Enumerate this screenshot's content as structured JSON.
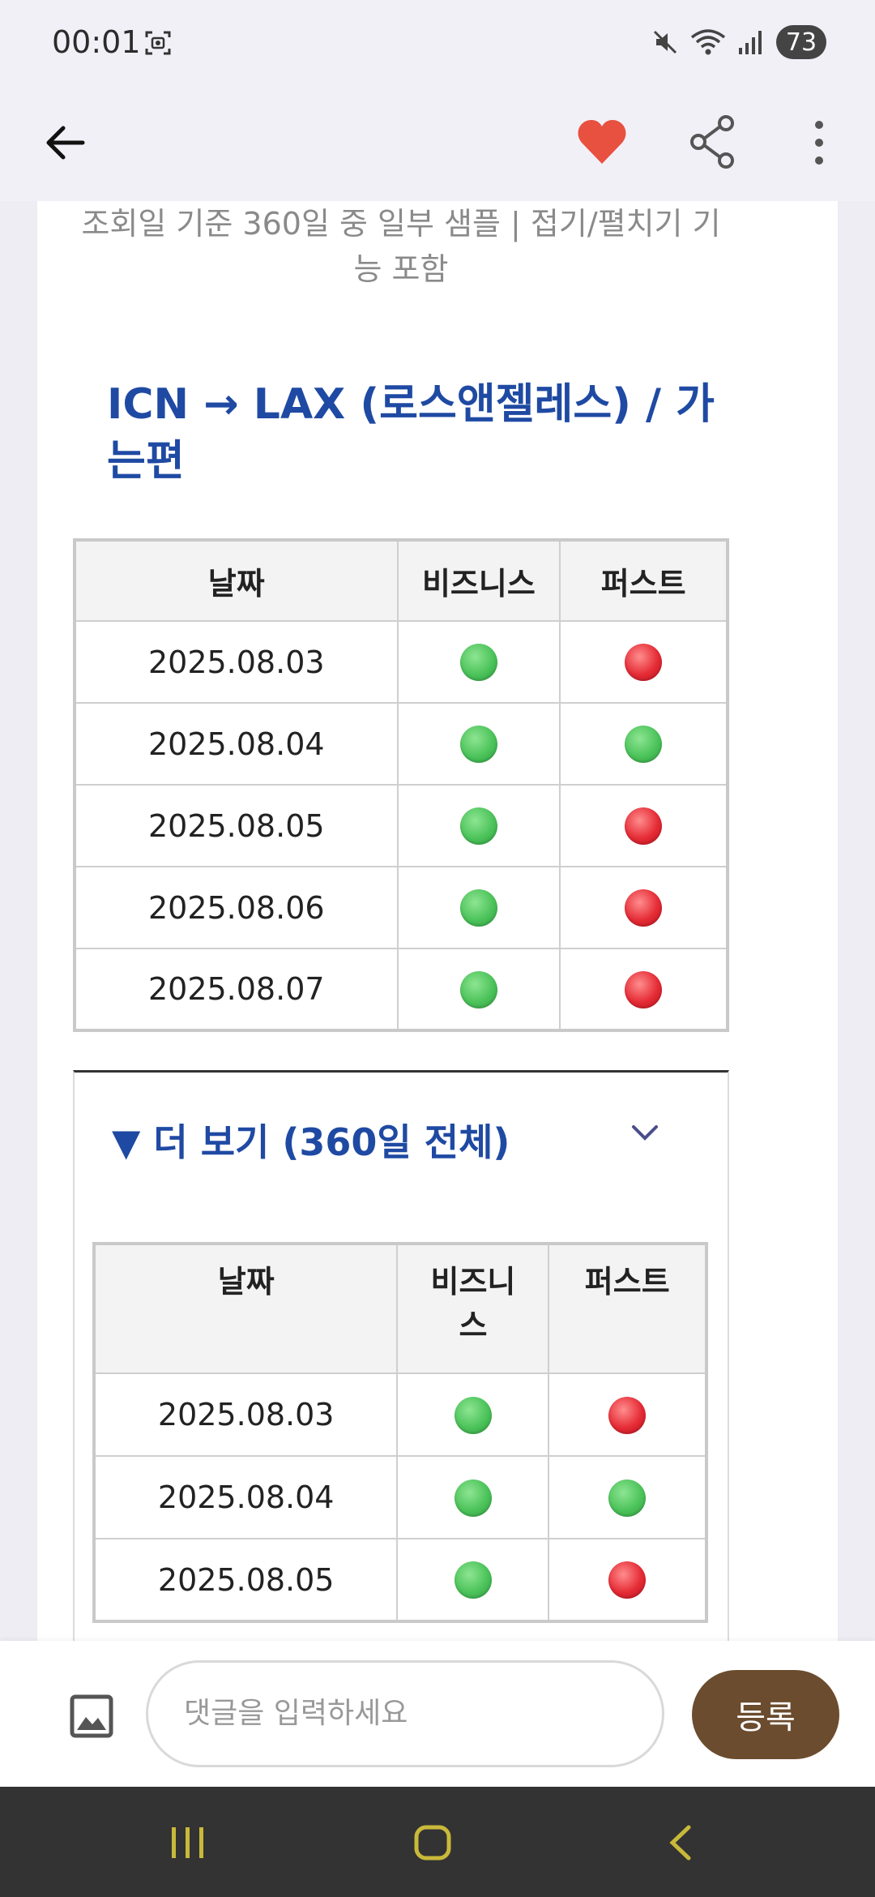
{
  "status_bar": {
    "time": "00:01",
    "battery": "73"
  },
  "app_bar": {
    "back_icon": "arrow-left-icon",
    "favorite_icon": "heart-icon",
    "share_icon": "share-icon",
    "more_icon": "more-vertical-icon",
    "favorite_color": "#e8503f"
  },
  "content": {
    "subtitle": "조회일 기준 360일 중 일부 샘플 | 접기/펼치기 기능 포함",
    "section_title": "ICN → LAX (로스앤젤레스) / 가는편",
    "table1": {
      "headers": [
        "날짜",
        "비즈니스",
        "퍼스트"
      ],
      "rows": [
        {
          "date": "2025.08.03",
          "business": "green",
          "first": "red"
        },
        {
          "date": "2025.08.04",
          "business": "green",
          "first": "green"
        },
        {
          "date": "2025.08.05",
          "business": "green",
          "first": "red"
        },
        {
          "date": "2025.08.06",
          "business": "green",
          "first": "red"
        },
        {
          "date": "2025.08.07",
          "business": "green",
          "first": "red"
        }
      ]
    },
    "details": {
      "summary": "▼ 더 보기 (360일 전체)",
      "table": {
        "headers": [
          "날짜",
          "비즈니스",
          "퍼스트"
        ],
        "rows": [
          {
            "date": "2025.08.03",
            "business": "green",
            "first": "red"
          },
          {
            "date": "2025.08.04",
            "business": "green",
            "first": "green"
          },
          {
            "date": "2025.08.05",
            "business": "green",
            "first": "red"
          }
        ]
      }
    }
  },
  "comment_bar": {
    "image_icon": "image-icon",
    "placeholder": "댓글을 입력하세요",
    "submit_label": "등록",
    "submit_color": "#6b4c2e"
  },
  "nav_bar": {
    "recent_icon": "recent-apps-icon",
    "home_icon": "home-icon",
    "back_icon": "back-chevron-icon",
    "icon_color": "#c8b93a"
  }
}
